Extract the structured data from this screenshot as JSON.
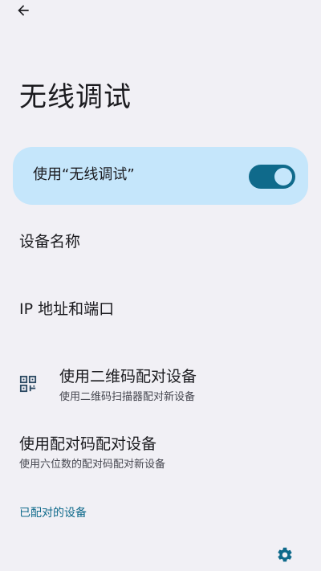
{
  "header": {
    "back_icon": "arrow-left-icon",
    "title": "无线调试"
  },
  "main_switch": {
    "label": "使用“无线调试”",
    "state": "on",
    "accent": "#0f6a8b",
    "card_color": "#c5e6fb"
  },
  "prefs": {
    "device_name": {
      "title": "设备名称"
    },
    "ip_port": {
      "title": "IP 地址和端口"
    },
    "pair_qr": {
      "icon": "qr-code-scanner-icon",
      "title": "使用二维码配对设备",
      "summary": "使用二维码扫描器配对新设备"
    },
    "pair_code": {
      "title": "使用配对码配对设备",
      "summary": "使用六位数的配对码配对新设备"
    }
  },
  "paired_section": {
    "header": "已配对的设备",
    "settings_icon": "gear-icon"
  }
}
